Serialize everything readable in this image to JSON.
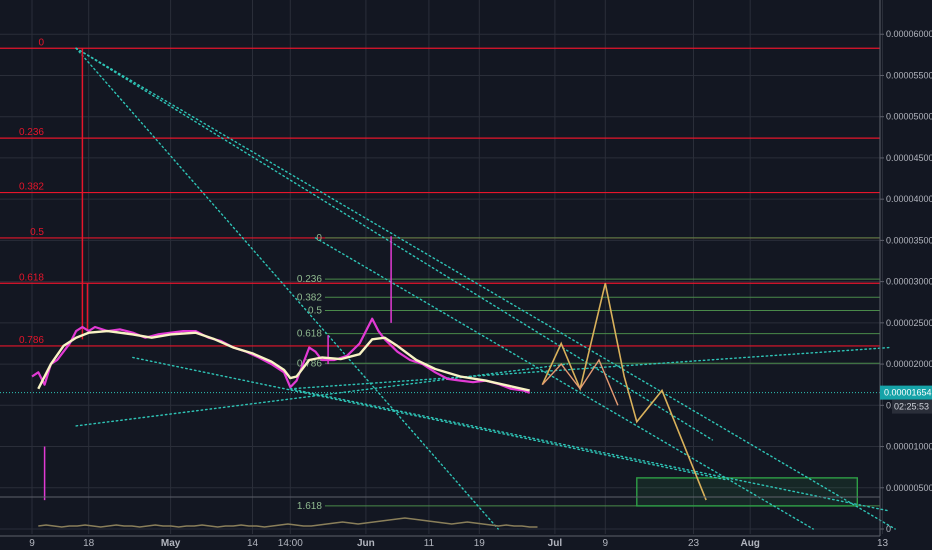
{
  "chart_data": {
    "type": "line",
    "symbol_note": "",
    "y_axis": {
      "ticks": [
        "0.00006000",
        "0.00005500",
        "0.00005000",
        "0.00004500",
        "0.00004000",
        "0.00003500",
        "0.00003000",
        "0.00002500",
        "0.00002000",
        "0.00001500",
        "0.00001000",
        "0.00000500",
        "0"
      ],
      "values": [
        6e-05,
        5.5e-05,
        5e-05,
        4.5e-05,
        4e-05,
        3.5e-05,
        3e-05,
        2.5e-05,
        2e-05,
        1.5e-05,
        1e-05,
        5e-06,
        0
      ],
      "last_price": "0.00001654",
      "countdown": "02:25:53"
    },
    "x_axis": {
      "labels": [
        {
          "text": "9",
          "bold": false,
          "pos": 0
        },
        {
          "text": "18",
          "bold": false,
          "pos": 9
        },
        {
          "text": "May",
          "bold": true,
          "pos": 22
        },
        {
          "text": "14",
          "bold": false,
          "pos": 35
        },
        {
          "text": "14:00",
          "bold": false,
          "pos": 41
        },
        {
          "text": "Jun",
          "bold": true,
          "pos": 53
        },
        {
          "text": "11",
          "bold": false,
          "pos": 63
        },
        {
          "text": "19",
          "bold": false,
          "pos": 71
        },
        {
          "text": "Jul",
          "bold": true,
          "pos": 83
        },
        {
          "text": "9",
          "bold": false,
          "pos": 91
        },
        {
          "text": "23",
          "bold": false,
          "pos": 105
        },
        {
          "text": "Aug",
          "bold": true,
          "pos": 114
        },
        {
          "text": "13",
          "bold": false,
          "pos": 135
        }
      ]
    },
    "fib_major": {
      "levels": [
        "0",
        "0.236",
        "0.382",
        "0.5",
        "0.618",
        "0.786"
      ],
      "prices": [
        5.83e-05,
        4.74e-05,
        4.08e-05,
        3.53e-05,
        2.98e-05,
        2.22e-05
      ]
    },
    "fib_minor": {
      "levels": [
        "0",
        "0.236",
        "0.382",
        "0.5",
        "0.618",
        "0.786",
        "1.618"
      ],
      "prices": [
        3.53e-05,
        3.03e-05,
        2.81e-05,
        2.65e-05,
        2.37e-05,
        2.01e-05,
        2.8e-06
      ]
    },
    "price_series": [
      {
        "d": 0,
        "v": 1.85e-05
      },
      {
        "d": 1,
        "v": 1.9e-05
      },
      {
        "d": 2,
        "v": 1.75e-05
      },
      {
        "d": 3,
        "v": 2e-05
      },
      {
        "d": 4,
        "v": 2.05e-05
      },
      {
        "d": 5,
        "v": 2.15e-05
      },
      {
        "d": 6,
        "v": 2.25e-05
      },
      {
        "d": 7,
        "v": 2.4e-05
      },
      {
        "d": 8,
        "v": 2.45e-05
      },
      {
        "d": 9,
        "v": 2.4e-05
      },
      {
        "d": 10,
        "v": 2.45e-05
      },
      {
        "d": 12,
        "v": 2.4e-05
      },
      {
        "d": 14,
        "v": 2.42e-05
      },
      {
        "d": 16,
        "v": 2.38e-05
      },
      {
        "d": 18,
        "v": 2.32e-05
      },
      {
        "d": 20,
        "v": 2.36e-05
      },
      {
        "d": 22,
        "v": 2.38e-05
      },
      {
        "d": 24,
        "v": 2.4e-05
      },
      {
        "d": 26,
        "v": 2.4e-05
      },
      {
        "d": 28,
        "v": 2.32e-05
      },
      {
        "d": 30,
        "v": 2.28e-05
      },
      {
        "d": 32,
        "v": 2.2e-05
      },
      {
        "d": 34,
        "v": 2.15e-05
      },
      {
        "d": 36,
        "v": 2.08e-05
      },
      {
        "d": 38,
        "v": 2e-05
      },
      {
        "d": 40,
        "v": 1.9e-05
      },
      {
        "d": 41,
        "v": 1.72e-05
      },
      {
        "d": 42,
        "v": 1.8e-05
      },
      {
        "d": 43,
        "v": 2e-05
      },
      {
        "d": 44,
        "v": 2.2e-05
      },
      {
        "d": 45,
        "v": 2.15e-05
      },
      {
        "d": 46,
        "v": 2.05e-05
      },
      {
        "d": 48,
        "v": 2.05e-05
      },
      {
        "d": 50,
        "v": 2.1e-05
      },
      {
        "d": 52,
        "v": 2.25e-05
      },
      {
        "d": 53,
        "v": 2.4e-05
      },
      {
        "d": 54,
        "v": 2.55e-05
      },
      {
        "d": 55,
        "v": 2.4e-05
      },
      {
        "d": 56,
        "v": 2.3e-05
      },
      {
        "d": 58,
        "v": 2.15e-05
      },
      {
        "d": 60,
        "v": 2.05e-05
      },
      {
        "d": 62,
        "v": 2e-05
      },
      {
        "d": 64,
        "v": 1.9e-05
      },
      {
        "d": 66,
        "v": 1.82e-05
      },
      {
        "d": 68,
        "v": 1.8e-05
      },
      {
        "d": 70,
        "v": 1.78e-05
      },
      {
        "d": 72,
        "v": 1.8e-05
      },
      {
        "d": 74,
        "v": 1.76e-05
      },
      {
        "d": 76,
        "v": 1.7e-05
      },
      {
        "d": 78,
        "v": 1.68e-05
      },
      {
        "d": 79,
        "v": 1.65e-05
      }
    ],
    "ma_series": [
      {
        "d": 1,
        "v": 1.7e-05
      },
      {
        "d": 3,
        "v": 2e-05
      },
      {
        "d": 5,
        "v": 2.22e-05
      },
      {
        "d": 7,
        "v": 2.32e-05
      },
      {
        "d": 9,
        "v": 2.38e-05
      },
      {
        "d": 12,
        "v": 2.4e-05
      },
      {
        "d": 16,
        "v": 2.36e-05
      },
      {
        "d": 19,
        "v": 2.32e-05
      },
      {
        "d": 22,
        "v": 2.36e-05
      },
      {
        "d": 26,
        "v": 2.38e-05
      },
      {
        "d": 29,
        "v": 2.3e-05
      },
      {
        "d": 32,
        "v": 2.2e-05
      },
      {
        "d": 35,
        "v": 2.13e-05
      },
      {
        "d": 38,
        "v": 2.03e-05
      },
      {
        "d": 40,
        "v": 1.93e-05
      },
      {
        "d": 41,
        "v": 1.83e-05
      },
      {
        "d": 42,
        "v": 1.85e-05
      },
      {
        "d": 44,
        "v": 2.05e-05
      },
      {
        "d": 46,
        "v": 2.08e-05
      },
      {
        "d": 49,
        "v": 2.06e-05
      },
      {
        "d": 52,
        "v": 2.12e-05
      },
      {
        "d": 54,
        "v": 2.3e-05
      },
      {
        "d": 56,
        "v": 2.32e-05
      },
      {
        "d": 58,
        "v": 2.22e-05
      },
      {
        "d": 61,
        "v": 2.05e-05
      },
      {
        "d": 64,
        "v": 1.94e-05
      },
      {
        "d": 68,
        "v": 1.85e-05
      },
      {
        "d": 72,
        "v": 1.8e-05
      },
      {
        "d": 76,
        "v": 1.73e-05
      },
      {
        "d": 79,
        "v": 1.68e-05
      }
    ],
    "spikes": [
      {
        "d": 8,
        "high": 5.83e-05,
        "low": 2.3e-05
      },
      {
        "d": 8.8,
        "high": 2.98e-05,
        "low": 2.4e-05
      },
      {
        "d": 2,
        "high": 1e-05,
        "low": 3.5e-06
      },
      {
        "d": 47,
        "high": 2.35e-05,
        "low": 2e-05
      },
      {
        "d": 57,
        "high": 3.55e-05,
        "low": 2.5e-05
      }
    ],
    "projection": [
      {
        "d": 81,
        "v": 1.75e-05
      },
      {
        "d": 84,
        "v": 2.25e-05
      },
      {
        "d": 87,
        "v": 1.7e-05
      },
      {
        "d": 91,
        "v": 2.98e-05
      },
      {
        "d": 94,
        "v": 1.85e-05
      },
      {
        "d": 96,
        "v": 1.3e-05
      },
      {
        "d": 100,
        "v": 1.68e-05
      },
      {
        "d": 107,
        "v": 3.5e-06
      }
    ],
    "projection_fill": [
      {
        "d": 81,
        "v": 1.75e-05
      },
      {
        "d": 84,
        "v": 2e-05
      },
      {
        "d": 87,
        "v": 1.7e-05
      },
      {
        "d": 90,
        "v": 2.05e-05
      },
      {
        "d": 93,
        "v": 1.5e-05
      }
    ],
    "trendlines": [
      {
        "from": {
          "d": 7,
          "v": 5.83e-05
        },
        "to": {
          "d": 137,
          "v": 0.0
        }
      },
      {
        "from": {
          "d": 7,
          "v": 5.83e-05
        },
        "to": {
          "d": 108,
          "v": 1.08e-05
        }
      },
      {
        "from": {
          "d": 7,
          "v": 5.83e-05
        },
        "to": {
          "d": 74,
          "v": 0.0
        }
      },
      {
        "from": {
          "d": 45,
          "v": 3.53e-05
        },
        "to": {
          "d": 124,
          "v": 0.0
        }
      },
      {
        "from": {
          "d": 16,
          "v": 2.08e-05
        },
        "to": {
          "d": 110,
          "v": 6e-06
        }
      },
      {
        "from": {
          "d": 41,
          "v": 1.7e-05
        },
        "to": {
          "d": 136,
          "v": 2.2e-05
        }
      },
      {
        "from": {
          "d": 7,
          "v": 1.25e-05
        },
        "to": {
          "d": 85,
          "v": 2e-05
        }
      },
      {
        "from": {
          "d": 41,
          "v": 1.7e-05
        },
        "to": {
          "d": 136,
          "v": 2.2e-06
        }
      }
    ],
    "target_box": {
      "d1": 96,
      "d2": 131,
      "v1": 6.2e-06,
      "v2": 2.8e-06
    },
    "volume": [
      2,
      3,
      2,
      1,
      2,
      2,
      3,
      2,
      1,
      2,
      3,
      2,
      2,
      1,
      2,
      3,
      2,
      2,
      1,
      2,
      2,
      3,
      2,
      1,
      2,
      2,
      3,
      2,
      2,
      1,
      2,
      3,
      4,
      3,
      2,
      2,
      3,
      4,
      5,
      6,
      5,
      4,
      5,
      6,
      7,
      8,
      9,
      10,
      9,
      8,
      7,
      6,
      5,
      4,
      5,
      6,
      5,
      4,
      3,
      2,
      3,
      2,
      2,
      1,
      1
    ],
    "colors": {
      "background": "#131722",
      "grid": "#2a2e39",
      "fib_major": "#e5152b",
      "fib_major_label": "#e5152b",
      "fib_minor": "#4a8a4a",
      "fib_minor_label": "#8fb98f",
      "price": "#e23ad4",
      "ma": "#f8f3c4",
      "trend": "#2ec4b6",
      "projection": "#d9b15b",
      "projection_up": "#e39a72",
      "target_box": "#2e9e46",
      "last_price_bg": "#16a3a8",
      "volume": "#8a7f5a"
    }
  }
}
